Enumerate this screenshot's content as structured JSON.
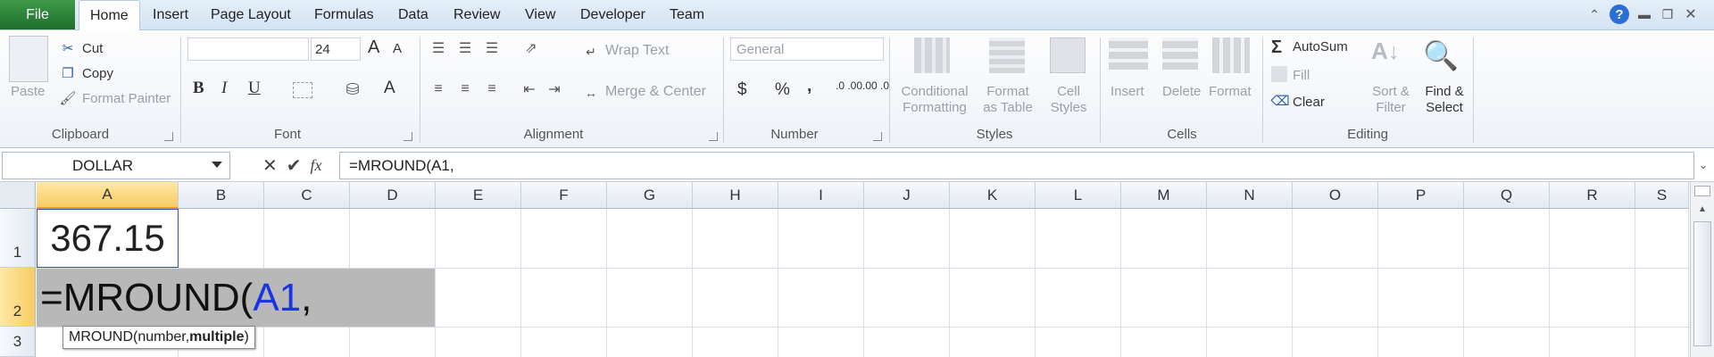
{
  "tabs": {
    "file": "File",
    "items": [
      "Home",
      "Insert",
      "Page Layout",
      "Formulas",
      "Data",
      "Review",
      "View",
      "Developer",
      "Team"
    ]
  },
  "clipboard": {
    "paste": "Paste",
    "cut": "Cut",
    "copy": "Copy",
    "format_painter": "Format Painter",
    "label": "Clipboard"
  },
  "font": {
    "size": "24",
    "bold": "B",
    "italic": "I",
    "underline": "U",
    "grow": "A",
    "shrink": "A",
    "label": "Font"
  },
  "alignment": {
    "wrap": "Wrap Text",
    "merge": "Merge & Center",
    "label": "Alignment"
  },
  "number": {
    "format": "General",
    "currency": "$",
    "percent": "%",
    "comma": ",",
    "inc_dec": ".0 .00",
    "dec_dec": ".00 .0",
    "label": "Number"
  },
  "styles": {
    "conditional": "Conditional",
    "conditional2": "Formatting",
    "format_table": "Format",
    "format_table2": "as Table",
    "cell_styles": "Cell",
    "cell_styles2": "Styles",
    "label": "Styles"
  },
  "cells": {
    "insert": "Insert",
    "delete": "Delete",
    "format": "Format",
    "label": "Cells"
  },
  "editing": {
    "autosum": "AutoSum",
    "fill": "Fill",
    "clear": "Clear",
    "sort": "Sort &",
    "sort2": "Filter",
    "find": "Find &",
    "find2": "Select",
    "label": "Editing"
  },
  "formula_bar": {
    "name_box": "DOLLAR",
    "formula": "=MROUND(A1,",
    "fx": "fx"
  },
  "columns": [
    "A",
    "B",
    "C",
    "D",
    "E",
    "F",
    "G",
    "H",
    "I",
    "J",
    "K",
    "L",
    "M",
    "N",
    "O",
    "P",
    "Q",
    "R",
    "S"
  ],
  "rows": [
    "1",
    "2",
    "3"
  ],
  "cells_data": {
    "a1": "367.15",
    "a2_prefix": "=MROUND(",
    "a2_ref": "A1",
    "a2_suffix": ","
  },
  "tooltip": {
    "fn": "MROUND(number, ",
    "bold_arg": "multiple",
    ")": ")"
  },
  "colors": {
    "ref_blue": "#1a35e0",
    "selection_gray": "#b8b8b8"
  }
}
